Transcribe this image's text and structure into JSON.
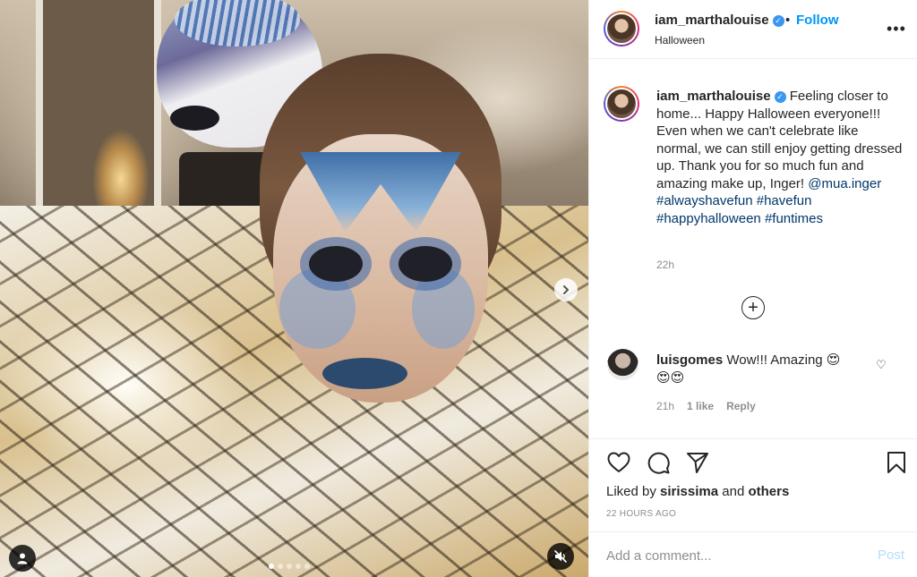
{
  "post": {
    "username": "iam_marthalouise",
    "verified": true,
    "follow_label": "Follow",
    "separator": "•",
    "location": "Halloween",
    "more_label": "•••"
  },
  "caption": {
    "username": "iam_marthalouise",
    "text": "Feeling closer to home... Happy Halloween everyone!!! Even when we can't celebrate like normal, we can still enjoy getting dressed up. Thank you for so much fun and amazing make up, Inger!",
    "mention": "@mua.inger",
    "hashtags": [
      "#alwayshavefun",
      "#havefun",
      "#happyhalloween",
      "#funtimes"
    ],
    "time": "22h"
  },
  "load_more_label": "+",
  "comments": [
    {
      "username": "luisgomes",
      "text": "Wow!!! Amazing 😍",
      "emoji_line": "😍😍",
      "time": "21h",
      "likes": "1 like",
      "reply_label": "Reply"
    }
  ],
  "actions": {
    "icons": [
      "heart-outline-icon",
      "comment-bubble-icon",
      "share-paper-plane-icon",
      "bookmark-icon"
    ],
    "liked_prefix": "Liked by",
    "liked_user": "sirissima",
    "liked_and": "and",
    "liked_others": "others",
    "timestamp": "22 HOURS AGO"
  },
  "add_comment": {
    "placeholder": "Add a comment...",
    "post_label": "Post"
  },
  "carousel": {
    "slide_count": 5,
    "active_slide": 1
  },
  "colors": {
    "follow": "#0095f6",
    "link": "#00376b",
    "muted": "#8e8e8e",
    "post_disabled": "#b2dffc",
    "verified": "#3897f0"
  }
}
